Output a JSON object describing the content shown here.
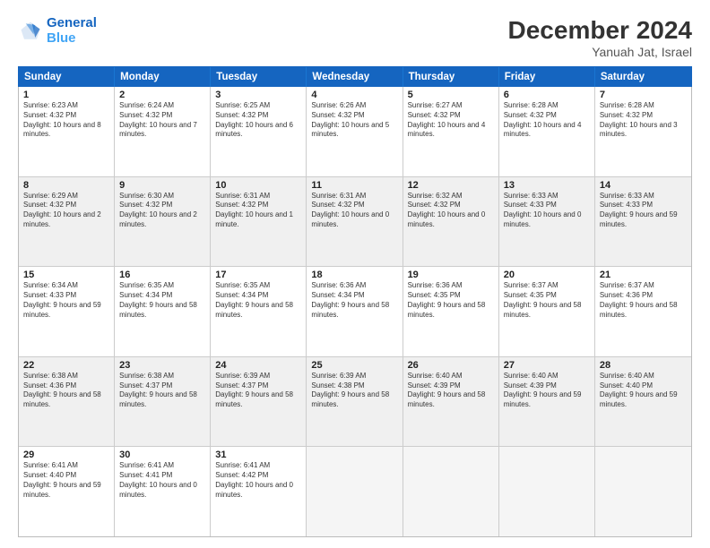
{
  "logo": {
    "line1": "General",
    "line2": "Blue"
  },
  "title": "December 2024",
  "location": "Yanuah Jat, Israel",
  "days": [
    "Sunday",
    "Monday",
    "Tuesday",
    "Wednesday",
    "Thursday",
    "Friday",
    "Saturday"
  ],
  "weeks": [
    [
      {
        "day": "1",
        "sunrise": "6:23 AM",
        "sunset": "4:32 PM",
        "daylight": "10 hours and 8 minutes."
      },
      {
        "day": "2",
        "sunrise": "6:24 AM",
        "sunset": "4:32 PM",
        "daylight": "10 hours and 7 minutes."
      },
      {
        "day": "3",
        "sunrise": "6:25 AM",
        "sunset": "4:32 PM",
        "daylight": "10 hours and 6 minutes."
      },
      {
        "day": "4",
        "sunrise": "6:26 AM",
        "sunset": "4:32 PM",
        "daylight": "10 hours and 5 minutes."
      },
      {
        "day": "5",
        "sunrise": "6:27 AM",
        "sunset": "4:32 PM",
        "daylight": "10 hours and 4 minutes."
      },
      {
        "day": "6",
        "sunrise": "6:28 AM",
        "sunset": "4:32 PM",
        "daylight": "10 hours and 4 minutes."
      },
      {
        "day": "7",
        "sunrise": "6:28 AM",
        "sunset": "4:32 PM",
        "daylight": "10 hours and 3 minutes."
      }
    ],
    [
      {
        "day": "8",
        "sunrise": "6:29 AM",
        "sunset": "4:32 PM",
        "daylight": "10 hours and 2 minutes."
      },
      {
        "day": "9",
        "sunrise": "6:30 AM",
        "sunset": "4:32 PM",
        "daylight": "10 hours and 2 minutes."
      },
      {
        "day": "10",
        "sunrise": "6:31 AM",
        "sunset": "4:32 PM",
        "daylight": "10 hours and 1 minute."
      },
      {
        "day": "11",
        "sunrise": "6:31 AM",
        "sunset": "4:32 PM",
        "daylight": "10 hours and 0 minutes."
      },
      {
        "day": "12",
        "sunrise": "6:32 AM",
        "sunset": "4:32 PM",
        "daylight": "10 hours and 0 minutes."
      },
      {
        "day": "13",
        "sunrise": "6:33 AM",
        "sunset": "4:33 PM",
        "daylight": "10 hours and 0 minutes."
      },
      {
        "day": "14",
        "sunrise": "6:33 AM",
        "sunset": "4:33 PM",
        "daylight": "9 hours and 59 minutes."
      }
    ],
    [
      {
        "day": "15",
        "sunrise": "6:34 AM",
        "sunset": "4:33 PM",
        "daylight": "9 hours and 59 minutes."
      },
      {
        "day": "16",
        "sunrise": "6:35 AM",
        "sunset": "4:34 PM",
        "daylight": "9 hours and 58 minutes."
      },
      {
        "day": "17",
        "sunrise": "6:35 AM",
        "sunset": "4:34 PM",
        "daylight": "9 hours and 58 minutes."
      },
      {
        "day": "18",
        "sunrise": "6:36 AM",
        "sunset": "4:34 PM",
        "daylight": "9 hours and 58 minutes."
      },
      {
        "day": "19",
        "sunrise": "6:36 AM",
        "sunset": "4:35 PM",
        "daylight": "9 hours and 58 minutes."
      },
      {
        "day": "20",
        "sunrise": "6:37 AM",
        "sunset": "4:35 PM",
        "daylight": "9 hours and 58 minutes."
      },
      {
        "day": "21",
        "sunrise": "6:37 AM",
        "sunset": "4:36 PM",
        "daylight": "9 hours and 58 minutes."
      }
    ],
    [
      {
        "day": "22",
        "sunrise": "6:38 AM",
        "sunset": "4:36 PM",
        "daylight": "9 hours and 58 minutes."
      },
      {
        "day": "23",
        "sunrise": "6:38 AM",
        "sunset": "4:37 PM",
        "daylight": "9 hours and 58 minutes."
      },
      {
        "day": "24",
        "sunrise": "6:39 AM",
        "sunset": "4:37 PM",
        "daylight": "9 hours and 58 minutes."
      },
      {
        "day": "25",
        "sunrise": "6:39 AM",
        "sunset": "4:38 PM",
        "daylight": "9 hours and 58 minutes."
      },
      {
        "day": "26",
        "sunrise": "6:40 AM",
        "sunset": "4:39 PM",
        "daylight": "9 hours and 58 minutes."
      },
      {
        "day": "27",
        "sunrise": "6:40 AM",
        "sunset": "4:39 PM",
        "daylight": "9 hours and 59 minutes."
      },
      {
        "day": "28",
        "sunrise": "6:40 AM",
        "sunset": "4:40 PM",
        "daylight": "9 hours and 59 minutes."
      }
    ],
    [
      {
        "day": "29",
        "sunrise": "6:41 AM",
        "sunset": "4:40 PM",
        "daylight": "9 hours and 59 minutes."
      },
      {
        "day": "30",
        "sunrise": "6:41 AM",
        "sunset": "4:41 PM",
        "daylight": "10 hours and 0 minutes."
      },
      {
        "day": "31",
        "sunrise": "6:41 AM",
        "sunset": "4:42 PM",
        "daylight": "10 hours and 0 minutes."
      },
      null,
      null,
      null,
      null
    ]
  ]
}
